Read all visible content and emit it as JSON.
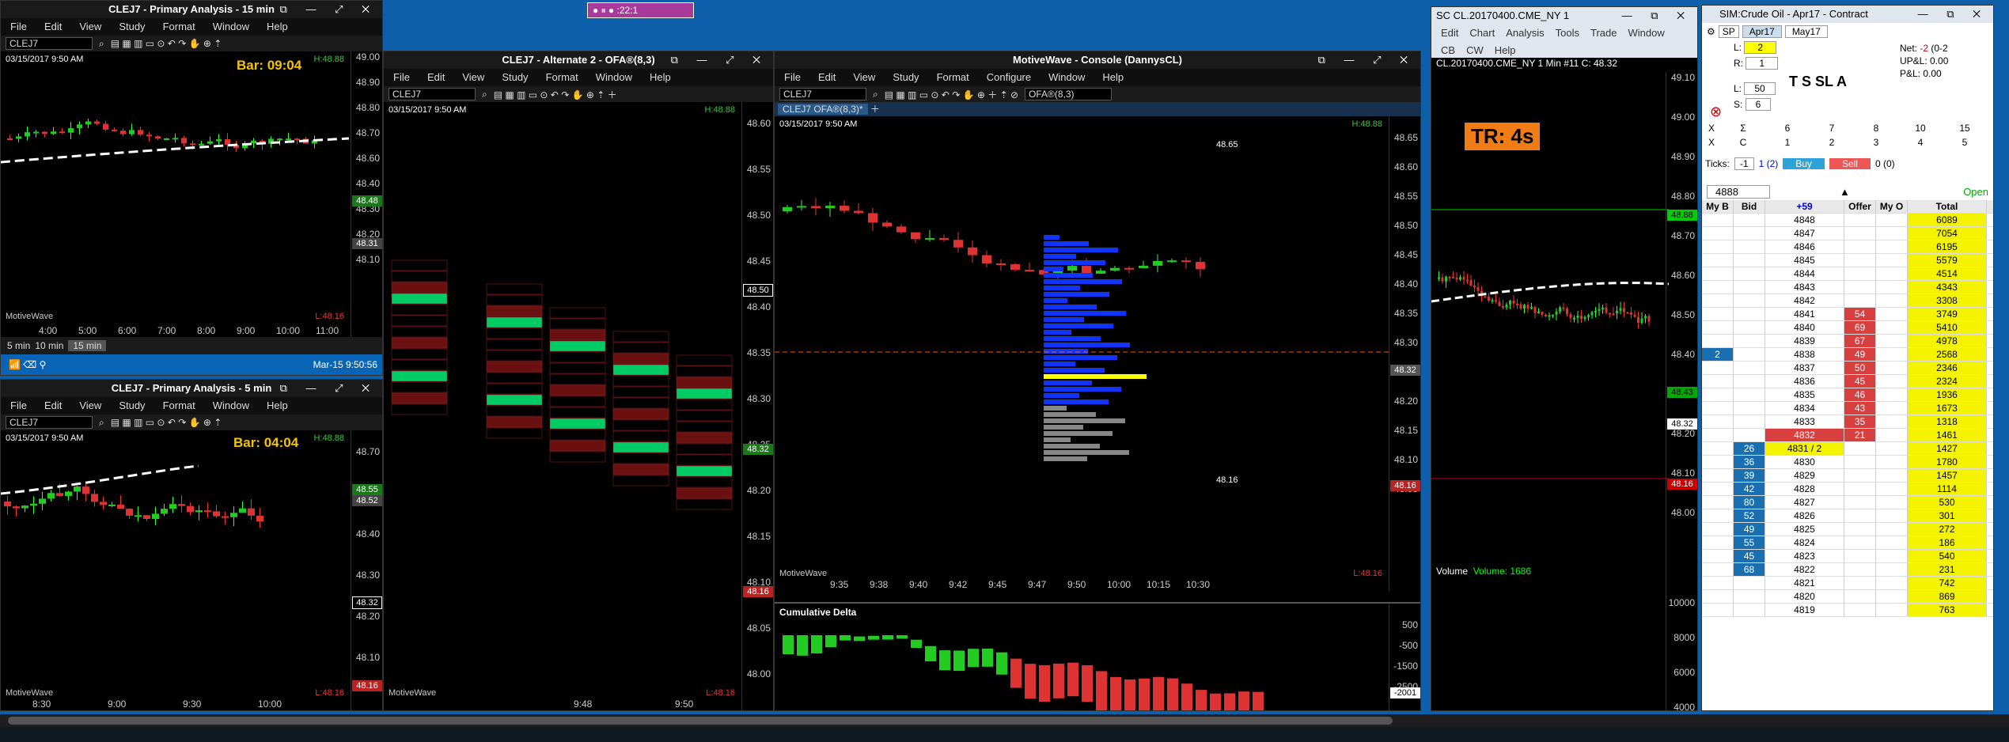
{
  "mw_toolbar": {
    "ratio": ":22:1"
  },
  "w1": {
    "title": "CLEJ7 - Primary Analysis - 15 min",
    "symbol": "CLEJ7",
    "date": "03/15/2017 9:50 AM",
    "bar": "Bar: 09:04",
    "hi": "H:48.88",
    "lo": "L:48.16",
    "brand": "MotiveWave",
    "y": [
      "49.00",
      "48.90",
      "48.80",
      "48.70",
      "48.60",
      "48.40",
      "48.30",
      "48.20",
      "48.10"
    ],
    "x": [
      "4:00",
      "5:00",
      "6:00",
      "7:00",
      "8:00",
      "9:00",
      "10:00",
      "11:00"
    ],
    "tags": [
      "48.48",
      "48.31"
    ],
    "intervals": [
      "5 min",
      "10 min",
      "15 min"
    ],
    "clock": "Mar-15 9:50:56"
  },
  "w2": {
    "title": "CLEJ7 - Primary Analysis - 5 min",
    "symbol": "CLEJ7",
    "date": "03/15/2017 9:50 AM",
    "bar": "Bar: 04:04",
    "hi": "H:48.88",
    "lo": "L:48.16",
    "brand": "MotiveWave",
    "y": [
      "48.70",
      "48.60",
      "48.40",
      "48.30",
      "48.20",
      "48.10"
    ],
    "x": [
      "8:30",
      "9:00",
      "9:30",
      "10:00"
    ],
    "tags": [
      "48.55",
      "48.52",
      "48.32",
      "48.16"
    ]
  },
  "w3": {
    "title": "CLEJ7 - Alternate 2 - OFA®(8,3)",
    "symbol": "CLEJ7",
    "date": "03/15/2017 9:50 AM",
    "hi": "H:48.88",
    "lo": "L:48.16",
    "brand": "MotiveWave",
    "y": [
      "48.60",
      "48.55",
      "48.50",
      "48.45",
      "48.40",
      "48.35",
      "48.30",
      "48.25",
      "48.20",
      "48.15",
      "48.10",
      "48.05",
      "48.00"
    ],
    "x": [
      "9:48",
      "9:50"
    ],
    "tags": [
      "48.50",
      "48.32",
      "48.16"
    ]
  },
  "w4": {
    "title": "MotiveWave - Console (DannysCL)",
    "symbol": "CLEJ7",
    "study": "OFA®(8,3)",
    "tab": "CLEJ7 OFA®(8,3)*",
    "date": "03/15/2017 9:50 AM",
    "hi": "H:48.88",
    "lo": "L:48.16",
    "brand": "MotiveWave",
    "y": [
      "48.65",
      "48.60",
      "48.55",
      "48.50",
      "48.45",
      "48.40",
      "48.35",
      "48.30",
      "48.25",
      "48.20",
      "48.15",
      "48.10",
      "48.05"
    ],
    "x": [
      "9:35",
      "9:38",
      "9:40",
      "9:42",
      "9:45",
      "9:47",
      "9:50",
      "10:00",
      "10:15",
      "10:30"
    ],
    "hl_hi": "48.65",
    "hl_lo": "48.16",
    "tags": [
      "48.32",
      "48.16"
    ],
    "delta": {
      "title": "Cumulative Delta",
      "y": [
        "500",
        "-500",
        "-1500",
        "-2500"
      ],
      "tag": "-2001"
    }
  },
  "w5": {
    "title": "SC CL.20170400.CME_NY 1",
    "menu": [
      "Edit",
      "Chart",
      "Analysis",
      "Tools",
      "Trade",
      "Window"
    ],
    "menu2": [
      "CB",
      "CW",
      "Help"
    ],
    "header": "CL.20170400.CME_NY  1 Min  #11  C: 48.32",
    "tr": "TR: 4s",
    "y": [
      "49.10",
      "49.00",
      "48.90",
      "48.80",
      "48.70",
      "48.60",
      "48.50",
      "48.40",
      "48.30",
      "48.20",
      "48.10",
      "48.00"
    ],
    "tags": [
      "48.88",
      "48.43",
      "48.32",
      "48.16"
    ],
    "volume_label": "Volume",
    "volume_value": "Volume: 1686",
    "vy": [
      "10000",
      "8000",
      "6000",
      "4000"
    ]
  },
  "w6": {
    "title": "SIM:Crude Oil - Apr17 - Contract",
    "months": [
      "SP",
      "Apr17",
      "May17"
    ],
    "L": "2",
    "R": "1",
    "Lq": "50",
    "S": "6",
    "net": "Net:",
    "net_v": "-2",
    "net_v2": "(0-2",
    "upl": "UP&L:",
    "upl_v": "0.00",
    "pl": "P&L:",
    "pl_v": "0.00",
    "grid1": [
      "6",
      "7",
      "8",
      "10",
      "15"
    ],
    "grid2": [
      "C",
      "1",
      "2",
      "3",
      "4",
      "5"
    ],
    "ticks_label": "Ticks:",
    "ticks": "-1",
    "ticks_n": "1 (2)",
    "buy": "Buy",
    "sell": "Sell",
    "pos": "0 (0)",
    "price_in": "4888",
    "open": "Open",
    "head": [
      "My B",
      "Bid",
      "+59",
      "Offer",
      "My O",
      "Total"
    ]
  },
  "dom": [
    [
      "",
      "",
      "4848",
      "",
      "",
      "6089"
    ],
    [
      "",
      "",
      "4847",
      "",
      "",
      "7054"
    ],
    [
      "",
      "",
      "4846",
      "",
      "",
      "6195"
    ],
    [
      "",
      "",
      "4845",
      "",
      "",
      "5579"
    ],
    [
      "",
      "",
      "4844",
      "",
      "",
      "4514"
    ],
    [
      "",
      "",
      "4843",
      "",
      "",
      "4343"
    ],
    [
      "",
      "",
      "4842",
      "",
      "",
      "3308"
    ],
    [
      "",
      "",
      "4841",
      "54",
      "",
      "3749"
    ],
    [
      "",
      "",
      "4840",
      "69",
      "",
      "5410"
    ],
    [
      "",
      "",
      "4839",
      "67",
      "",
      "4978"
    ],
    [
      "2",
      "",
      "4838",
      "49",
      "",
      "2568"
    ],
    [
      "",
      "",
      "4837",
      "50",
      "",
      "2346"
    ],
    [
      "",
      "",
      "4836",
      "45",
      "",
      "2324"
    ],
    [
      "",
      "",
      "4835",
      "46",
      "",
      "1936"
    ],
    [
      "",
      "",
      "4834",
      "43",
      "",
      "1673"
    ],
    [
      "",
      "",
      "4833",
      "35",
      "",
      "1318"
    ],
    [
      "",
      "",
      "4832",
      "21",
      "",
      "1461"
    ],
    [
      "",
      "26",
      "4831 / 2",
      "",
      "",
      "1427"
    ],
    [
      "",
      "36",
      "4830",
      "",
      "",
      "1780"
    ],
    [
      "",
      "39",
      "4829",
      "",
      "",
      "1457"
    ],
    [
      "",
      "42",
      "4828",
      "",
      "",
      "1114"
    ],
    [
      "",
      "80",
      "4827",
      "",
      "",
      "530"
    ],
    [
      "",
      "52",
      "4826",
      "",
      "",
      "301"
    ],
    [
      "",
      "49",
      "4825",
      "",
      "",
      "272"
    ],
    [
      "",
      "55",
      "4824",
      "",
      "",
      "186"
    ],
    [
      "",
      "45",
      "4823",
      "",
      "",
      "540"
    ],
    [
      "",
      "68",
      "4822",
      "",
      "",
      "231"
    ],
    [
      "",
      "",
      "4821",
      "",
      "",
      "742"
    ],
    [
      "",
      "",
      "4820",
      "",
      "",
      "869"
    ],
    [
      "",
      "",
      "4819",
      "",
      "",
      "763"
    ]
  ],
  "menus": {
    "std": [
      "File",
      "Edit",
      "View",
      "Study",
      "Format",
      "Window",
      "Help"
    ],
    "console": [
      "File",
      "Edit",
      "View",
      "Study",
      "Format",
      "Configure",
      "Window",
      "Help"
    ]
  }
}
